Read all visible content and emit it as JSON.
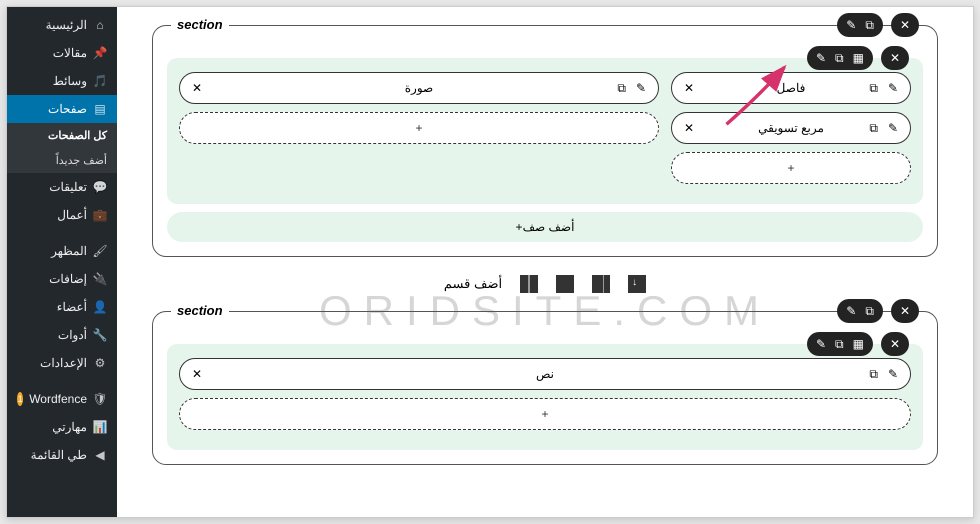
{
  "sidebar": {
    "home": "الرئيسية",
    "posts": "مقالات",
    "media": "وسائط",
    "pages": "صفحات",
    "all_pages": "كل الصفحات",
    "add_new": "أضف جديداً",
    "comments": "تعليقات",
    "works": "أعمال",
    "appearance": "المظهر",
    "plugins": "إضافات",
    "users": "أعضاء",
    "tools": "أدوات",
    "settings": "الإعدادات",
    "wordfence": "Wordfence",
    "skills": "مهارتي",
    "collapse": "طي القائمة"
  },
  "builder": {
    "section_label": "section",
    "elements": {
      "image": "صورة",
      "divider": "فاصل",
      "marketing_box": "مربع تسويقي",
      "text": "نص"
    },
    "add_row": "أضف صف",
    "add_section": "أضف قسم",
    "add_plus": "+"
  },
  "watermark": "ORIDSITE.COM"
}
